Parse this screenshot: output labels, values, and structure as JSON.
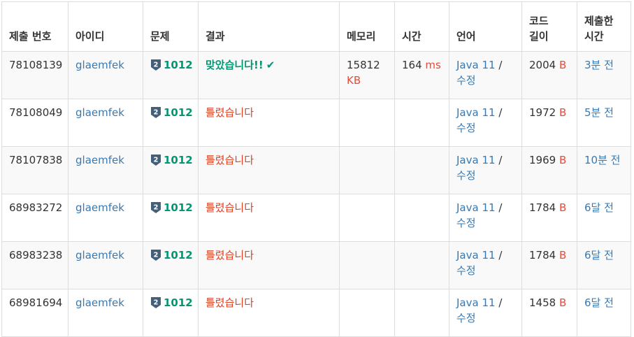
{
  "headers": {
    "submission_id": "제출 번호",
    "user": "아이디",
    "problem": "문제",
    "result": "결과",
    "memory": "메모리",
    "time": "시간",
    "language": "언어",
    "code_length": "코드 길이",
    "submitted": "제출한 시간"
  },
  "rows": [
    {
      "id": "78108139",
      "user": "glaemfek",
      "tier": "2",
      "problem": "1012",
      "result": "맞았습니다!!",
      "memory": "15812",
      "memory_unit": "KB",
      "time": "164",
      "time_unit": "ms",
      "lang": "Java 11",
      "slash": "/",
      "edit": "수정",
      "len": "2004",
      "len_unit": "B",
      "ago": "3분 전"
    },
    {
      "id": "78108049",
      "user": "glaemfek",
      "tier": "2",
      "problem": "1012",
      "result": "틀렸습니다",
      "memory": "",
      "memory_unit": "",
      "time": "",
      "time_unit": "",
      "lang": "Java 11",
      "slash": "/",
      "edit": "수정",
      "len": "1972",
      "len_unit": "B",
      "ago": "5분 전"
    },
    {
      "id": "78107838",
      "user": "glaemfek",
      "tier": "2",
      "problem": "1012",
      "result": "틀렸습니다",
      "memory": "",
      "memory_unit": "",
      "time": "",
      "time_unit": "",
      "lang": "Java 11",
      "slash": "/",
      "edit": "수정",
      "len": "1969",
      "len_unit": "B",
      "ago": "10분 전"
    },
    {
      "id": "68983272",
      "user": "glaemfek",
      "tier": "2",
      "problem": "1012",
      "result": "틀렸습니다",
      "memory": "",
      "memory_unit": "",
      "time": "",
      "time_unit": "",
      "lang": "Java 11",
      "slash": "/",
      "edit": "수정",
      "len": "1784",
      "len_unit": "B",
      "ago": "6달 전"
    },
    {
      "id": "68983238",
      "user": "glaemfek",
      "tier": "2",
      "problem": "1012",
      "result": "틀렸습니다",
      "memory": "",
      "memory_unit": "",
      "time": "",
      "time_unit": "",
      "lang": "Java 11",
      "slash": "/",
      "edit": "수정",
      "len": "1784",
      "len_unit": "B",
      "ago": "6달 전"
    },
    {
      "id": "68981694",
      "user": "glaemfek",
      "tier": "2",
      "problem": "1012",
      "result": "틀렸습니다",
      "memory": "",
      "memory_unit": "",
      "time": "",
      "time_unit": "",
      "lang": "Java 11",
      "slash": "/",
      "edit": "수정",
      "len": "1458",
      "len_unit": "B",
      "ago": "6달 전"
    }
  ],
  "result_colors": {
    "accepted": "#009874",
    "wrong": "#dd4124"
  },
  "link_color": "#337ab7",
  "icons": {
    "tier": "silver-tier-icon",
    "check": "checkmark-icon"
  }
}
